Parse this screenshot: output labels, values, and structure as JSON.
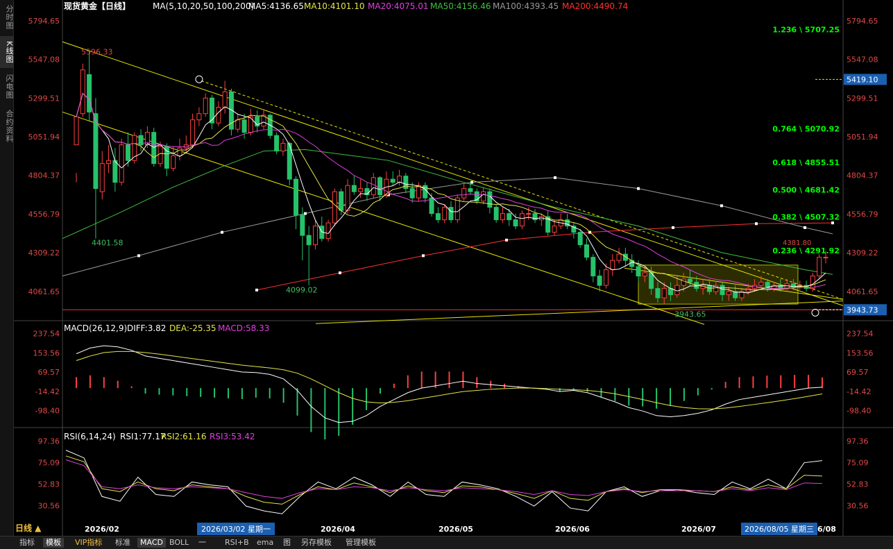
{
  "left_tabs": [
    "分时图",
    "K线图",
    "闪电图",
    "合约资料"
  ],
  "period_label": "日线 ▲",
  "bottom_tabs": [
    "指标",
    "模板",
    "VIP指标",
    "标准",
    "MACD",
    "BOLL",
    "一",
    "RSI+B",
    "ema",
    "图",
    "另存模板",
    "管理模板"
  ],
  "main_header": {
    "instrument": "现货黄金【日线】",
    "ma_params": "MA(5,10,20,50,100,200)",
    "ma5": "MA5:4136.65",
    "ma10": "MA10:4101.10",
    "ma20": "MA20:4075.01",
    "ma50": "MA50:4156.46",
    "ma100": "MA100:4393.45",
    "ma200": "MA200:4490.74"
  },
  "macd_header": {
    "params": "MACD(26,12,9)",
    "diff": "DIFF:3.82",
    "dea": "DEA:-25.35",
    "macd": "MACD:58.33"
  },
  "rsi_header": {
    "params": "RSI(6,14,24)",
    "rsi1": "RSI1:77.17",
    "rsi2": "RSI2:61.16",
    "rsi3": "RSI3:53.42"
  },
  "colors": {
    "up": "#ff4040",
    "down": "#26c26a",
    "ma5": "#ffffff",
    "ma10": "#e6e64a",
    "ma20": "#e040e0",
    "ma50": "#40c040",
    "ma100": "#9a9a9a",
    "ma200": "#ff3030",
    "trend": "#e6e600",
    "fib": "#00ff00"
  },
  "chart_data": [
    {
      "type": "candlestick",
      "title": "现货黄金【日线】",
      "y_ticks": [
        "5794.65",
        "5547.08",
        "5299.51",
        "5051.94",
        "4804.37",
        "4556.79",
        "4309.22",
        "4061.65"
      ],
      "ylim": [
        3905,
        5830
      ],
      "x_ticks": [
        "2026/02",
        "2026/04",
        "2026/05",
        "2026/06",
        "2026/07",
        "2026/08"
      ],
      "highlighted_dates": [
        "2026/03/02 星期一",
        "2026/08/05 星期三"
      ],
      "annotations": {
        "high": "5596.33",
        "low1": "4401.58",
        "low2": "4099.02",
        "low3": "3943.65",
        "tag_upper": "5419.10",
        "tag_lower": "3943.73",
        "fib_top_partial": "1.236 \\ 5707.25",
        "hidden_label": "4381.80"
      },
      "fib_levels": [
        {
          "label": "0.764 \\ 5070.92",
          "value": 5070.92
        },
        {
          "label": "0.618 \\ 4855.51",
          "value": 4855.51
        },
        {
          "label": "0.500 \\ 4681.42",
          "value": 4681.42
        },
        {
          "label": "0.382 \\ 4507.32",
          "value": 4507.32
        },
        {
          "label": "0.236 \\ 4291.92",
          "value": 4291.92
        }
      ],
      "candles": [
        [
          5000,
          5180,
          4820,
          4760
        ],
        [
          5200,
          5480,
          5520,
          5180
        ],
        [
          5450,
          5210,
          5600,
          5150
        ],
        [
          5200,
          4720,
          5300,
          4400
        ],
        [
          4700,
          4880,
          4960,
          4650
        ],
        [
          4880,
          4900,
          5000,
          4820
        ],
        [
          4900,
          4760,
          4980,
          4700
        ],
        [
          4760,
          5000,
          5040,
          4740
        ],
        [
          5000,
          4900,
          5080,
          4860
        ],
        [
          4900,
          5060,
          5080,
          4880
        ],
        [
          5060,
          5000,
          5100,
          4960
        ],
        [
          5000,
          5080,
          5120,
          4980
        ],
        [
          5080,
          4880,
          5110,
          4860
        ],
        [
          4880,
          4990,
          5020,
          4860
        ],
        [
          4990,
          4850,
          5010,
          4800
        ],
        [
          4850,
          4930,
          4990,
          4830
        ],
        [
          4930,
          4980,
          5040,
          4900
        ],
        [
          4980,
          5000,
          5060,
          4950
        ],
        [
          5000,
          5160,
          5200,
          4980
        ],
        [
          5160,
          5200,
          5240,
          5120
        ],
        [
          5200,
          5300,
          5330,
          5180
        ],
        [
          5300,
          5140,
          5320,
          5100
        ],
        [
          5140,
          5240,
          5280,
          5120
        ],
        [
          5240,
          5340,
          5410,
          5200
        ],
        [
          5340,
          5100,
          5360,
          5060
        ],
        [
          5100,
          5160,
          5200,
          5080
        ],
        [
          5160,
          5080,
          5200,
          5040
        ],
        [
          5080,
          5180,
          5230,
          5060
        ],
        [
          5180,
          5120,
          5220,
          5080
        ],
        [
          5120,
          5190,
          5230,
          5100
        ],
        [
          5190,
          5060,
          5200,
          5040
        ],
        [
          5060,
          4960,
          5080,
          4940
        ],
        [
          4960,
          5010,
          5040,
          4930
        ],
        [
          5010,
          4780,
          5020,
          4740
        ],
        [
          4780,
          4550,
          4800,
          4460
        ],
        [
          4550,
          4420,
          4600,
          4260
        ],
        [
          4420,
          4360,
          4480,
          4100
        ],
        [
          4360,
          4480,
          4520,
          4330
        ],
        [
          4480,
          4400,
          4540,
          4380
        ],
        [
          4400,
          4500,
          4520,
          4380
        ],
        [
          4500,
          4700,
          4720,
          4480
        ],
        [
          4700,
          4580,
          4720,
          4550
        ],
        [
          4580,
          4740,
          4780,
          4560
        ],
        [
          4740,
          4700,
          4800,
          4680
        ],
        [
          4700,
          4720,
          4780,
          4660
        ],
        [
          4720,
          4680,
          4760,
          4640
        ],
        [
          4680,
          4790,
          4820,
          4660
        ],
        [
          4790,
          4680,
          4800,
          4640
        ],
        [
          4680,
          4780,
          4830,
          4660
        ],
        [
          4780,
          4760,
          4830,
          4740
        ],
        [
          4760,
          4800,
          4840,
          4740
        ],
        [
          4800,
          4720,
          4820,
          4690
        ],
        [
          4720,
          4660,
          4760,
          4630
        ],
        [
          4660,
          4740,
          4760,
          4640
        ],
        [
          4740,
          4660,
          4760,
          4630
        ],
        [
          4660,
          4560,
          4690,
          4540
        ],
        [
          4560,
          4520,
          4600,
          4500
        ],
        [
          4520,
          4600,
          4620,
          4500
        ],
        [
          4600,
          4520,
          4640,
          4500
        ],
        [
          4520,
          4660,
          4680,
          4500
        ],
        [
          4660,
          4720,
          4750,
          4640
        ],
        [
          4720,
          4700,
          4760,
          4680
        ],
        [
          4700,
          4640,
          4720,
          4620
        ],
        [
          4640,
          4700,
          4730,
          4620
        ],
        [
          4700,
          4600,
          4720,
          4560
        ],
        [
          4600,
          4520,
          4620,
          4500
        ],
        [
          4520,
          4560,
          4600,
          4500
        ],
        [
          4560,
          4520,
          4590,
          4480
        ],
        [
          4520,
          4480,
          4560,
          4460
        ],
        [
          4480,
          4560,
          4580,
          4460
        ],
        [
          4560,
          4560,
          4600,
          4520
        ],
        [
          4560,
          4520,
          4590,
          4500
        ],
        [
          4520,
          4540,
          4560,
          4480
        ],
        [
          4540,
          4440,
          4580,
          4420
        ],
        [
          4440,
          4480,
          4520,
          4420
        ],
        [
          4480,
          4520,
          4560,
          4460
        ],
        [
          4520,
          4480,
          4560,
          4460
        ],
        [
          4480,
          4440,
          4500,
          4400
        ],
        [
          4440,
          4360,
          4460,
          4340
        ],
        [
          4360,
          4280,
          4400,
          4260
        ],
        [
          4280,
          4160,
          4300,
          4120
        ],
        [
          4160,
          4100,
          4200,
          4060
        ],
        [
          4100,
          4200,
          4240,
          4080
        ],
        [
          4200,
          4260,
          4300,
          4160
        ],
        [
          4260,
          4300,
          4340,
          4240
        ],
        [
          4300,
          4260,
          4340,
          4220
        ],
        [
          4260,
          4220,
          4300,
          4180
        ],
        [
          4220,
          4160,
          4260,
          4120
        ],
        [
          4160,
          4180,
          4220,
          4120
        ],
        [
          4180,
          4080,
          4220,
          4040
        ],
        [
          4080,
          4020,
          4120,
          3990
        ],
        [
          4020,
          4080,
          4120,
          3980
        ],
        [
          4080,
          4040,
          4120,
          4000
        ],
        [
          4040,
          4100,
          4160,
          4020
        ],
        [
          4100,
          4140,
          4180,
          4060
        ],
        [
          4140,
          4120,
          4200,
          4100
        ],
        [
          4120,
          4080,
          4160,
          4060
        ],
        [
          4080,
          4100,
          4140,
          4040
        ],
        [
          4100,
          4060,
          4140,
          4040
        ],
        [
          4060,
          4100,
          4130,
          4040
        ],
        [
          4100,
          4040,
          4120,
          4000
        ],
        [
          4040,
          4060,
          4090,
          4000
        ],
        [
          4060,
          4020,
          4100,
          4000
        ],
        [
          4020,
          4060,
          4080,
          4000
        ],
        [
          4060,
          4080,
          4110,
          4040
        ],
        [
          4080,
          4100,
          4140,
          4060
        ],
        [
          4100,
          4120,
          4160,
          4080
        ],
        [
          4120,
          4080,
          4140,
          4060
        ],
        [
          4080,
          4100,
          4120,
          4060
        ],
        [
          4100,
          4080,
          4140,
          4060
        ],
        [
          4080,
          4110,
          4140,
          4060
        ],
        [
          4110,
          4090,
          4140,
          4070
        ],
        [
          4090,
          4100,
          4130,
          4070
        ],
        [
          4100,
          4080,
          4130,
          4060
        ],
        [
          4080,
          4160,
          4180,
          4060
        ],
        [
          4160,
          4280,
          4300,
          4140
        ],
        [
          4280,
          4280,
          4320,
          4240
        ]
      ]
    },
    {
      "type": "bar+line",
      "title": "MACD(26,12,9)",
      "y_ticks": [
        "237.54",
        "153.56",
        "69.57",
        "-14.42",
        "-98.40"
      ],
      "ylim": [
        -160,
        270
      ],
      "series": [
        {
          "name": "DIFF",
          "values": [
            150,
            175,
            185,
            180,
            165,
            140,
            130,
            120,
            110,
            100,
            90,
            80,
            70,
            68,
            60,
            40,
            -10,
            -80,
            -130,
            -150,
            -145,
            -120,
            -80,
            -50,
            -20,
            0,
            10,
            20,
            30,
            20,
            15,
            10,
            5,
            0,
            -5,
            -15,
            -10,
            -20,
            -40,
            -60,
            -85,
            -100,
            -120,
            -125,
            -120,
            -110,
            -95,
            -70,
            -50,
            -40,
            -30,
            -20,
            -10,
            0,
            3.82
          ]
        },
        {
          "name": "DEA",
          "values": [
            120,
            140,
            155,
            160,
            160,
            155,
            148,
            140,
            132,
            124,
            116,
            108,
            100,
            94,
            88,
            80,
            65,
            40,
            10,
            -20,
            -45,
            -60,
            -65,
            -62,
            -55,
            -45,
            -35,
            -25,
            -15,
            -10,
            -5,
            -2,
            0,
            0,
            -2,
            -5,
            -7,
            -10,
            -16,
            -25,
            -37,
            -50,
            -64,
            -76,
            -85,
            -90,
            -91,
            -87,
            -80,
            -72,
            -64,
            -55,
            -46,
            -36,
            -25.35
          ]
        }
      ]
    },
    {
      "type": "line",
      "title": "RSI(6,14,24)",
      "y_ticks": [
        "97.36",
        "75.09",
        "52.83",
        "30.56"
      ],
      "ylim": [
        15,
        105
      ],
      "series": [
        {
          "name": "RSI1",
          "values": [
            88,
            80,
            40,
            35,
            60,
            42,
            40,
            55,
            52,
            50,
            30,
            25,
            22,
            40,
            55,
            48,
            60,
            52,
            40,
            55,
            42,
            40,
            55,
            52,
            48,
            40,
            30,
            45,
            28,
            25,
            45,
            50,
            40,
            46,
            47,
            44,
            42,
            55,
            48,
            58,
            48,
            75,
            77.17
          ]
        },
        {
          "name": "RSI2",
          "values": [
            82,
            76,
            48,
            45,
            55,
            48,
            46,
            52,
            50,
            48,
            40,
            34,
            32,
            42,
            50,
            47,
            54,
            50,
            44,
            51,
            46,
            44,
            51,
            50,
            47,
            43,
            38,
            46,
            38,
            36,
            45,
            48,
            44,
            47,
            47,
            46,
            45,
            50,
            47,
            52,
            48,
            62,
            61.16
          ]
        },
        {
          "name": "RSI3",
          "values": [
            78,
            72,
            50,
            48,
            52,
            49,
            48,
            50,
            49,
            48,
            44,
            40,
            38,
            44,
            48,
            47,
            50,
            49,
            46,
            49,
            47,
            46,
            49,
            48,
            47,
            45,
            42,
            46,
            42,
            41,
            45,
            47,
            45,
            46,
            46,
            46,
            45,
            48,
            46,
            49,
            47,
            54,
            53.42
          ]
        }
      ]
    }
  ]
}
